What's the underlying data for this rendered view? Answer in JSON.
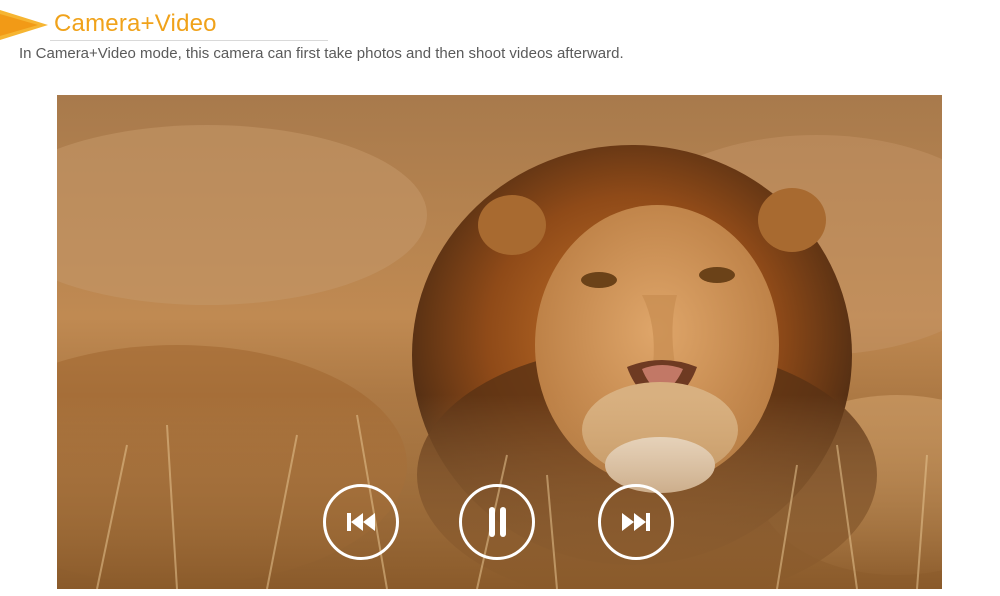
{
  "header": {
    "title": "Camera+Video",
    "description": "In Camera+Video mode, this camera can first take photos and then shoot videos afterward.",
    "accent_color": "#f0a21a"
  },
  "video": {
    "subject": "lion-in-grass-photo",
    "controls": {
      "previous_icon": "skip-previous-icon",
      "pause_icon": "pause-icon",
      "next_icon": "skip-next-icon"
    }
  }
}
